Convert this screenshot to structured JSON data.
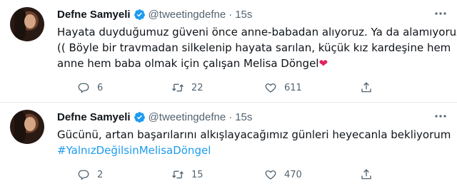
{
  "colors": {
    "text": "#0f1419",
    "secondary": "#536471",
    "link": "#1d9bf0",
    "verified": "#1d9bf0",
    "heart": "#e0245e",
    "divider": "#e6ecf0"
  },
  "tweets": [
    {
      "author_name": "Defne Samyeli",
      "handle": "@tweetingdefne",
      "separator": "·",
      "time": "15s",
      "text_lines": [
        "Hayata duyduğumuz güveni önce anne-babadan alıyoruz. Ya da alamıyoruz:",
        "(( Böyle bir travmadan silkelenip hayata sarılan, küçük kız kardeşine hem",
        "anne hem baba olmak için çalışan Melisa Döngel"
      ],
      "emoji": "❤",
      "reply_count": "6",
      "retweet_count": "22",
      "like_count": "611"
    },
    {
      "author_name": "Defne Samyeli",
      "handle": "@tweetingdefne",
      "separator": "·",
      "time": "15s",
      "text_lines": [
        "Gücünü, artan başarılarını alkışlayacağımız günleri heyecanla bekliyorum"
      ],
      "hashtag": "#YalnızDeğilsinMelisaDöngel",
      "reply_count": "2",
      "retweet_count": "15",
      "like_count": "470"
    }
  ],
  "icons": {
    "verified": "verified-badge-icon",
    "more": "more-dots-icon",
    "reply": "reply-bubble-icon",
    "retweet": "retweet-arrows-icon",
    "like": "heart-outline-icon",
    "share": "share-upload-icon"
  }
}
